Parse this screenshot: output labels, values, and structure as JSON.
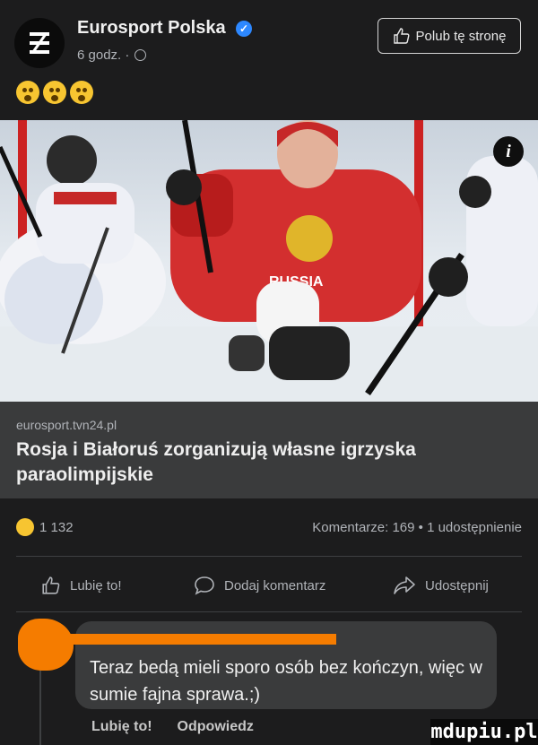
{
  "header": {
    "page_name": "Eurosport Polska",
    "time": "6 godz. ·",
    "like_page_label": "Polub tę stronę",
    "emojis": [
      "astonished-face",
      "astonished-face",
      "astonished-face"
    ]
  },
  "photo": {
    "jersey_text": "RUSSIA",
    "info_label": "i"
  },
  "link_preview": {
    "domain": "eurosport.tvn24.pl",
    "title": "Rosja i Białoruś zorganizują własne igrzyska paraolimpijskie"
  },
  "stats": {
    "reaction_icon": "astonished-face",
    "reactions_count": "1 132",
    "comments_shares": "Komentarze: 169 • 1 udostępnienie"
  },
  "actions": {
    "like": "Lubię to!",
    "comment": "Dodaj komentarz",
    "share": "Udostępnij"
  },
  "comment": {
    "text": "Teraz bedą mieli sporo osób bez kończyn, więc w sumie fajna sprawa.;)",
    "like_label": "Lubię to!",
    "reply_label": "Odpowiedz"
  },
  "watermark": "mdupiu.pl",
  "colors": {
    "background": "#1c1c1d",
    "card": "#3a3b3c",
    "redaction": "#f57c00",
    "verified": "#2d88ff"
  }
}
